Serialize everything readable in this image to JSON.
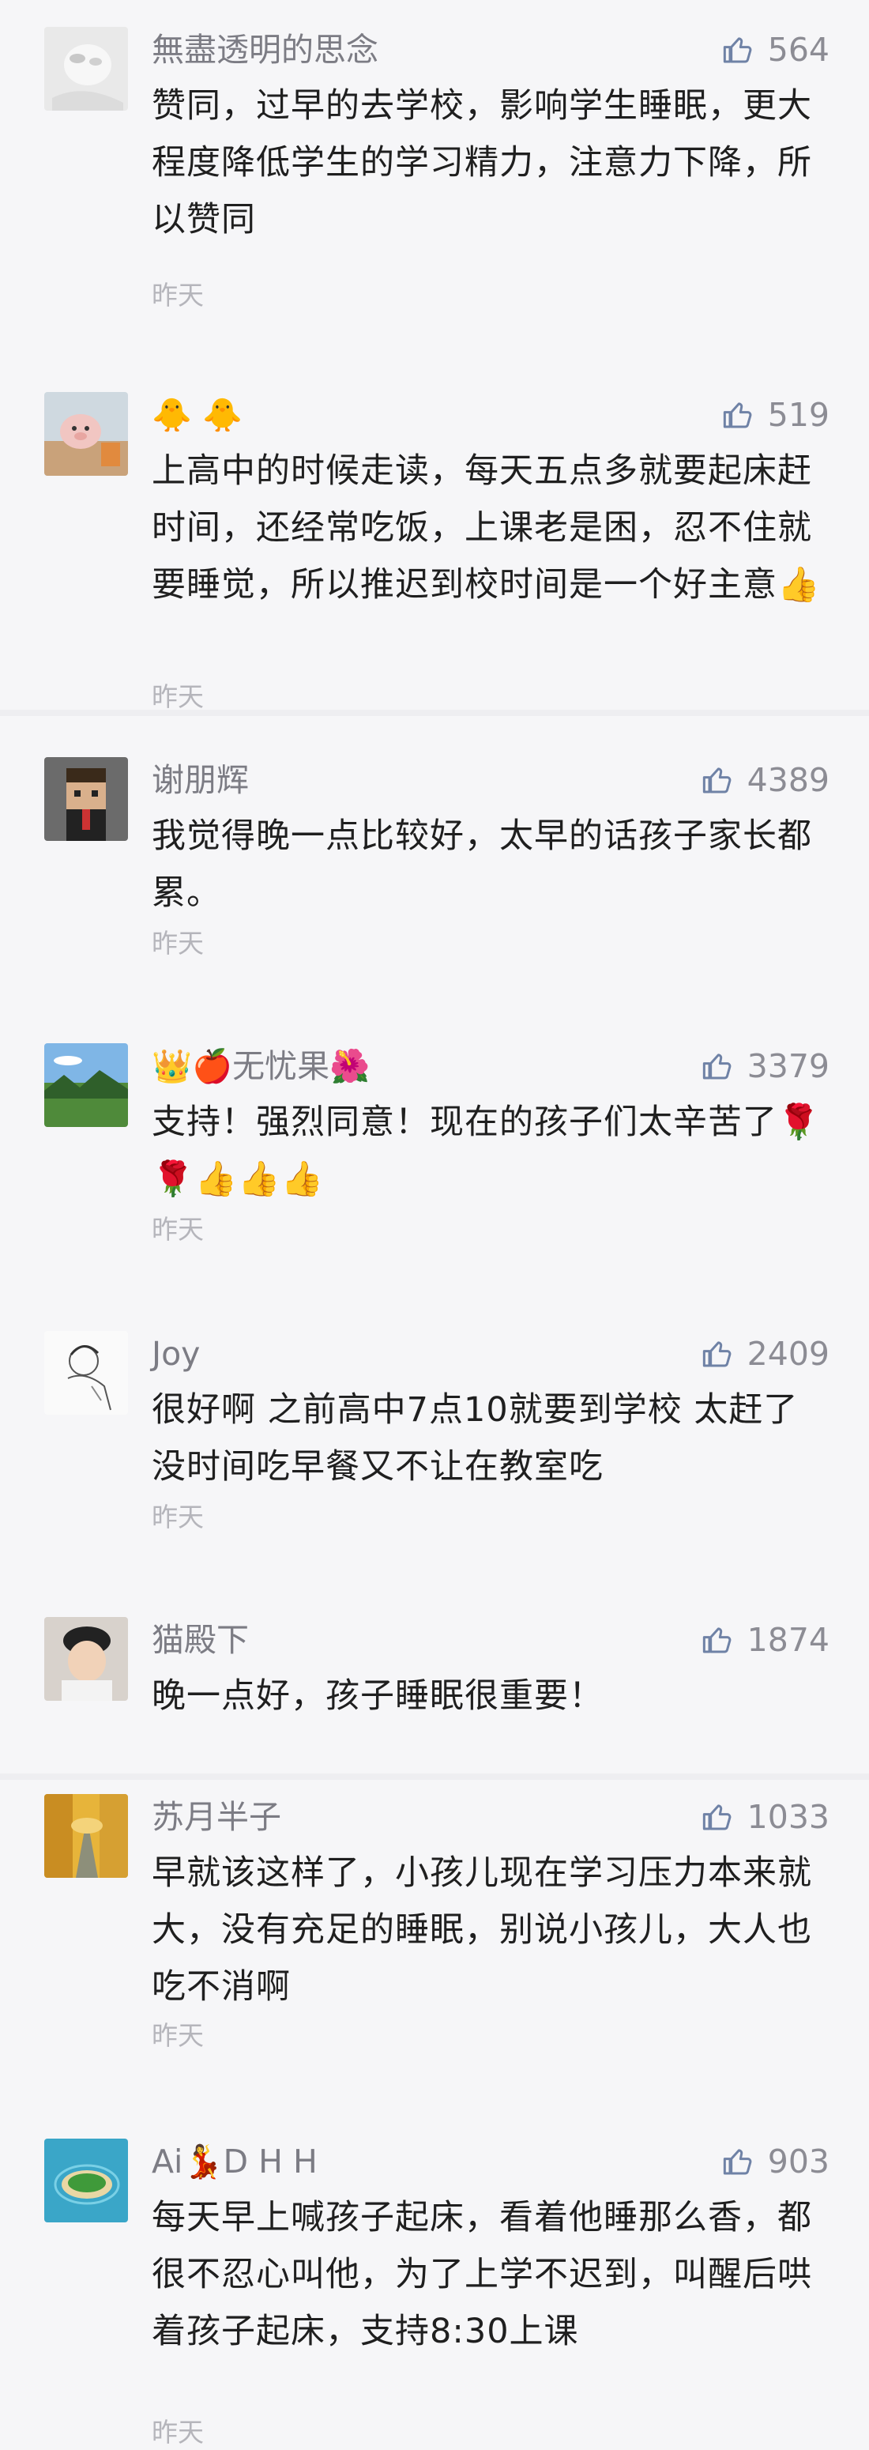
{
  "comments": [
    {
      "username": "無盡透明的思念",
      "likes": "564",
      "text": "赞同，过早的去学校，影响学生睡眠，更大程度降低学生的学习精力，注意力下降，所以赞同",
      "time": "昨天",
      "avatar": "blurred-portrait-avatar"
    },
    {
      "username": "🐥 🐥",
      "likes": "519",
      "text": "上高中的时候走读，每天五点多就要起床赶时间，还经常吃饭，上课老是困，忍不住就要睡觉，所以推迟到校时间是一个好主意👍",
      "time": "昨天",
      "avatar": "pig-photo-avatar"
    },
    {
      "username": "谢朋辉",
      "likes": "4389",
      "text": "我觉得晚一点比较好，太早的话孩子家长都累。",
      "time": "昨天",
      "avatar": "pixel-character-avatar"
    },
    {
      "username": "👑🍎无忧果🌺",
      "likes": "3379",
      "text": "支持！强烈同意！现在的孩子们太辛苦了🌹🌹👍👍👍",
      "time": "昨天",
      "avatar": "landscape-avatar"
    },
    {
      "username": "Joy",
      "likes": "2409",
      "text": "很好啊 之前高中7点10就要到学校 太赶了没时间吃早餐又不让在教室吃",
      "time": "昨天",
      "avatar": "sketch-avatar"
    },
    {
      "username": "猫殿下",
      "likes": "1874",
      "text": "晚一点好，孩子睡眠很重要！",
      "time": "",
      "avatar": "child-photo-avatar"
    },
    {
      "username": "苏月半子",
      "likes": "1033",
      "text": "早就该这样了，小孩儿现在学习压力本来就大，没有充足的睡眠，别说小孩儿，大人也吃不消啊",
      "time": "昨天",
      "avatar": "autumn-path-avatar"
    },
    {
      "username": "Ai💃D H H",
      "likes": "903",
      "text": "每天早上喊孩子起床，看着他睡那么香，都很不忍心叫他，为了上学不迟到，叫醒后哄着孩子起床，支持8:30上课",
      "time": "昨天",
      "avatar": "island-avatar"
    }
  ],
  "colors": {
    "background": "#f6f6f8",
    "username": "#7c7c84",
    "body_text": "#1f1f1f",
    "timestamp": "#b5b5bb",
    "like_icon": "#8c8c94"
  }
}
